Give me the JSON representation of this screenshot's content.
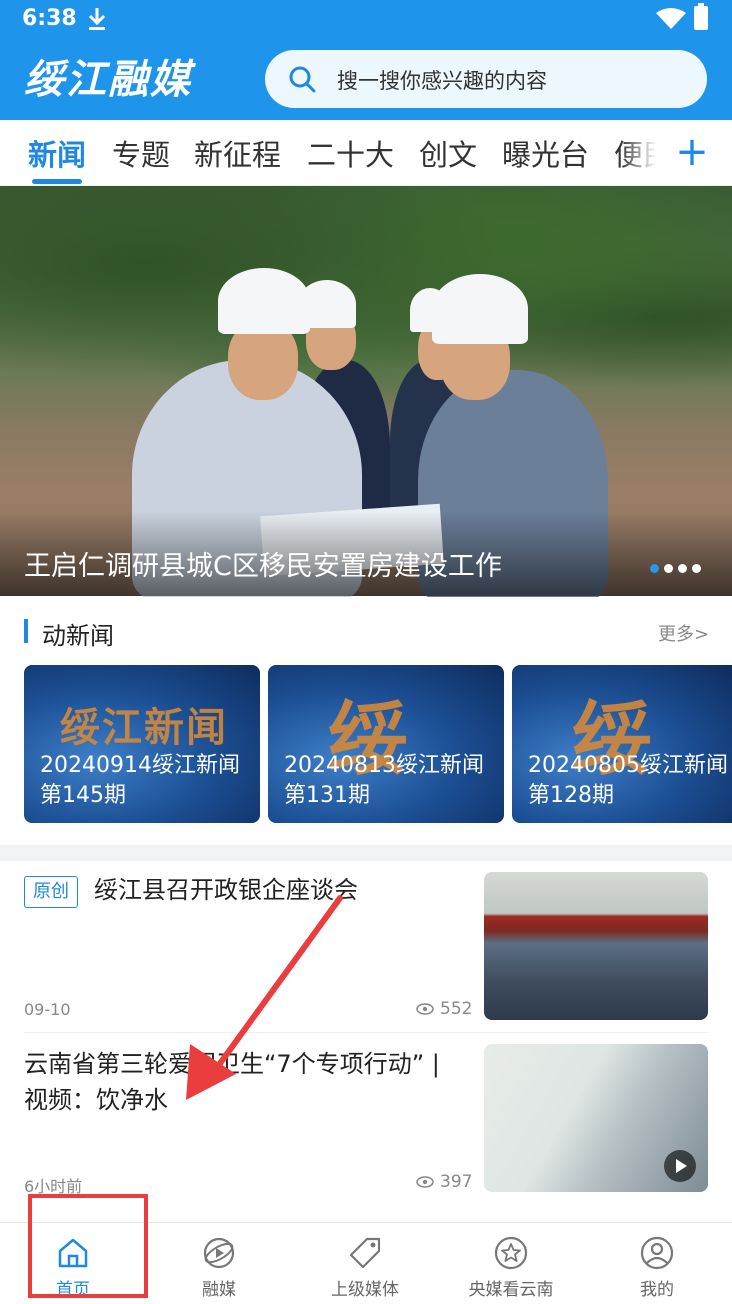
{
  "status_bar": {
    "time": "6:38"
  },
  "header": {
    "logo_text": "绥江融媒",
    "search_placeholder": "搜一搜你感兴趣的内容"
  },
  "tabs": [
    {
      "label": "新闻",
      "active": true
    },
    {
      "label": "专题"
    },
    {
      "label": "新征程"
    },
    {
      "label": "二十大"
    },
    {
      "label": "创文"
    },
    {
      "label": "曝光台"
    },
    {
      "label": "便民"
    }
  ],
  "tab_add_label": "+",
  "banner": {
    "title": "王启仁调研县城C区移民安置房建设工作",
    "slide_count": 4,
    "active_slide": 1
  },
  "video_section": {
    "title": "动新闻",
    "more": "更多>",
    "items": [
      {
        "title": "20240914绥江新闻第145期",
        "char": "绥江新闻"
      },
      {
        "title": "20240813绥江新闻第131期",
        "char": "绥"
      },
      {
        "title": "20240805绥江新闻第128期",
        "char": "绥"
      }
    ]
  },
  "news": [
    {
      "badge": "原创",
      "title": "绥江县召开政银企座谈会",
      "time": "09-10",
      "views": "552"
    },
    {
      "title": "云南省第三轮爱国卫生“7个专项行动” | 视频：饮净水",
      "time": "6小时前",
      "views": "397",
      "has_video": true
    }
  ],
  "bottom_nav": [
    {
      "label": "首页",
      "icon": "home-icon",
      "active": true
    },
    {
      "label": "融媒",
      "icon": "media-icon"
    },
    {
      "label": "上级媒体",
      "icon": "tag-icon"
    },
    {
      "label": "央媒看云南",
      "icon": "star-icon"
    },
    {
      "label": "我的",
      "icon": "user-icon"
    }
  ],
  "colors": {
    "brand": "#1e95ea",
    "accent": "#1e88e5",
    "annotation": "#ea3d3d"
  }
}
